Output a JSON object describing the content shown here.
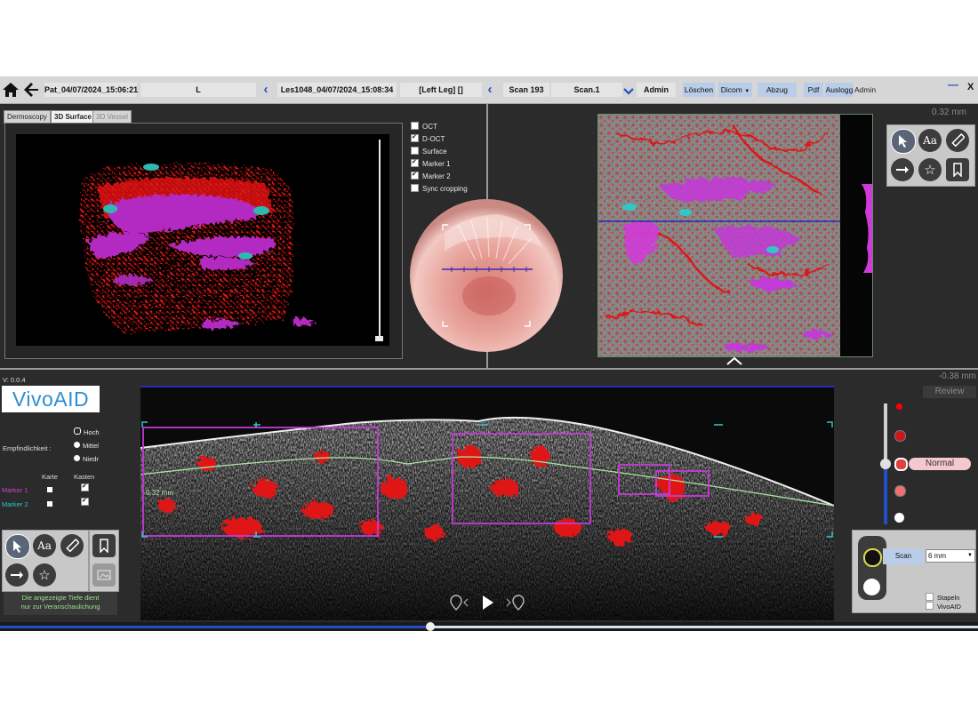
{
  "topbar": {
    "patient": "Pat_04/07/2024_15:06:21",
    "side": "L",
    "lesion": "Les1048_04/07/2024_15:08:34",
    "location": "[Left Leg] []",
    "scan_label": "Scan 193",
    "scan_select": "Scan.1",
    "user": "Admin",
    "delete_label": "Löschen",
    "dicom_label": "Dicom",
    "abzug_label": "Abzug",
    "pdf_label": "Pdf",
    "logout_label": "Auslogg",
    "admin_label": "Admin",
    "minimize_label": "—",
    "close_label": "X"
  },
  "left_panel": {
    "tabs": [
      "Dermoscopy",
      "3D Surface",
      "3D Vessel"
    ],
    "active_tab": 1,
    "layers": [
      {
        "label": "OCT",
        "checked": false
      },
      {
        "label": "D-OCT",
        "checked": true
      },
      {
        "label": "Surface",
        "checked": false
      },
      {
        "label": "Marker 1",
        "checked": true
      },
      {
        "label": "Marker 2",
        "checked": true
      },
      {
        "label": "Sync cropping",
        "checked": false
      }
    ]
  },
  "right_panel": {
    "depth_readout": "0.32 mm",
    "tools": [
      "pointer-icon",
      "text-icon",
      "ruler-icon",
      "arrow-icon",
      "star-icon",
      "bookmark-icon"
    ],
    "tool_text_label": "Aa"
  },
  "bottom": {
    "version": "V:  0.0.4",
    "logo_text": "VivoAID",
    "sensitivity_label": "Empfindlichkeit :",
    "sensitivity_options": [
      {
        "label": "Hoch",
        "selected": false
      },
      {
        "label": "Mittel",
        "selected": true
      },
      {
        "label": "Niedr",
        "selected": true
      }
    ],
    "col_map": "Karte",
    "col_box": "Kasten",
    "markers": [
      {
        "label": "Marker 1",
        "color": "#cc44cc",
        "map": false,
        "box": true
      },
      {
        "label": "Marker 2",
        "color": "#33c6c6",
        "map": false,
        "box": true
      }
    ],
    "depth_note_line1": "Die angezeigte Tiefe dient",
    "depth_note_line2": "nur zur Veranschaulichung",
    "depth_readout": "-0.38 mm",
    "review_label": "Review",
    "bscan_depth_label": "0.32 mm",
    "level_label": "Normal",
    "scan_button": "Scan",
    "scan_length": "6 mm",
    "stack_label": "Stapeln",
    "vivoaid_check_label": "VivoAID",
    "playback_progress": 0.44
  },
  "colors": {
    "vessel_red": "#e01414",
    "marker_magenta": "#c23bd6",
    "marker_cyan": "#33c6c6",
    "accent_blue": "#2050c8",
    "trace_green": "#a8e6a0",
    "level_pink": "#f4c8cc"
  }
}
